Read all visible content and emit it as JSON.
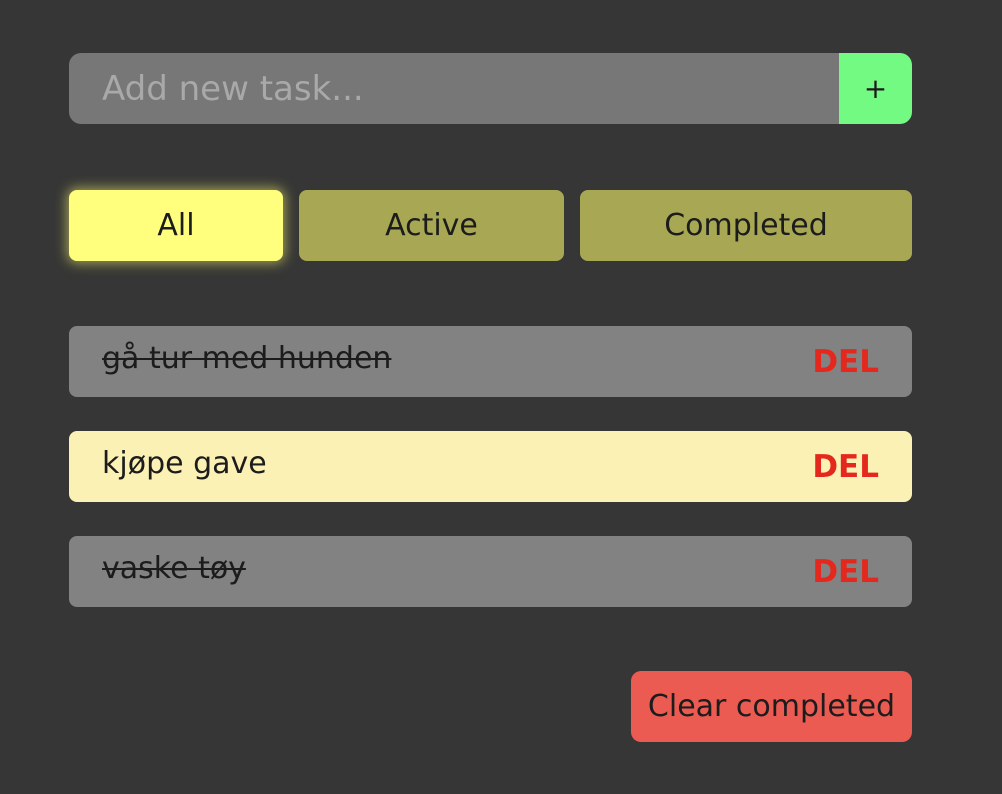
{
  "new_task": {
    "placeholder": "Add new task...",
    "value": "",
    "add_label": "+"
  },
  "filters": [
    {
      "label": "All",
      "selected": true
    },
    {
      "label": "Active",
      "selected": false
    },
    {
      "label": "Completed",
      "selected": false
    }
  ],
  "todos": [
    {
      "text": "gå tur med hunden",
      "completed": true,
      "delete_label": "DEL"
    },
    {
      "text": "kjøpe gave",
      "completed": false,
      "delete_label": "DEL"
    },
    {
      "text": "vaske tøy",
      "completed": true,
      "delete_label": "DEL"
    }
  ],
  "clear_label": "Clear completed",
  "colors": {
    "background": "#363636",
    "input": "#777777",
    "add_button": "#72fa82",
    "filter_selected": "#ffff7d",
    "filter": "#a8a854",
    "item_completed": "#828282",
    "item_active": "#fcf1b4",
    "delete": "#e4281d",
    "clear_button": "#ec5b52"
  }
}
